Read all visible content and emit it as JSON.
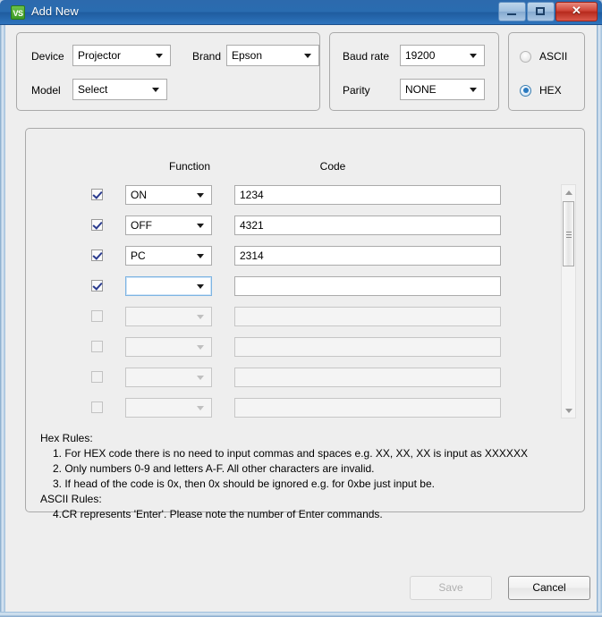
{
  "window": {
    "title": "Add New",
    "icon": "VS",
    "controls": {
      "minimize": "minimize",
      "maximize": "maximize",
      "close": "✕"
    }
  },
  "device_panel": {
    "device_label": "Device",
    "device_value": "Projector",
    "brand_label": "Brand",
    "brand_value": "Epson",
    "model_label": "Model",
    "model_value": "Select"
  },
  "serial_panel": {
    "baud_label": "Baud rate",
    "baud_value": "19200",
    "parity_label": "Parity",
    "parity_value": "NONE"
  },
  "format_panel": {
    "ascii_label": "ASCII",
    "ascii_selected": false,
    "hex_label": "HEX",
    "hex_selected": true
  },
  "table": {
    "headers": {
      "function": "Function",
      "code": "Code"
    },
    "rows": [
      {
        "checked": true,
        "enabled": true,
        "focused": false,
        "function": "ON",
        "code": "1234"
      },
      {
        "checked": true,
        "enabled": true,
        "focused": false,
        "function": "OFF",
        "code": "4321"
      },
      {
        "checked": true,
        "enabled": true,
        "focused": false,
        "function": "PC",
        "code": "2314"
      },
      {
        "checked": true,
        "enabled": true,
        "focused": true,
        "function": "",
        "code": ""
      },
      {
        "checked": false,
        "enabled": false,
        "focused": false,
        "function": "",
        "code": ""
      },
      {
        "checked": false,
        "enabled": false,
        "focused": false,
        "function": "",
        "code": ""
      },
      {
        "checked": false,
        "enabled": false,
        "focused": false,
        "function": "",
        "code": ""
      },
      {
        "checked": false,
        "enabled": false,
        "focused": false,
        "function": "",
        "code": ""
      },
      {
        "checked": false,
        "enabled": false,
        "focused": false,
        "function": "",
        "code": ""
      }
    ]
  },
  "rules": {
    "hex_heading": "Hex Rules:",
    "hex_1": "1. For HEX code there is no need to input commas and spaces e.g. XX, XX, XX  is input as XXXXXX",
    "hex_2": "2. Only numbers 0-9 and letters A-F. All other characters are invalid.",
    "hex_3": "3. If head of the code is 0x, then 0x should be ignored e.g. for 0xbe just input be.",
    "ascii_heading": "ASCII Rules:",
    "ascii_4": "4.CR represents 'Enter'. Please note the number of Enter commands."
  },
  "footer": {
    "save_label": "Save",
    "save_enabled": false,
    "cancel_label": "Cancel",
    "cancel_enabled": true
  },
  "colors": {
    "titlebar": "#2a6cb0",
    "close_button": "#cf4437",
    "accent_radio": "#2a7ac0",
    "check_mark": "#2a3b8f",
    "client_bg": "#eeeeee"
  }
}
